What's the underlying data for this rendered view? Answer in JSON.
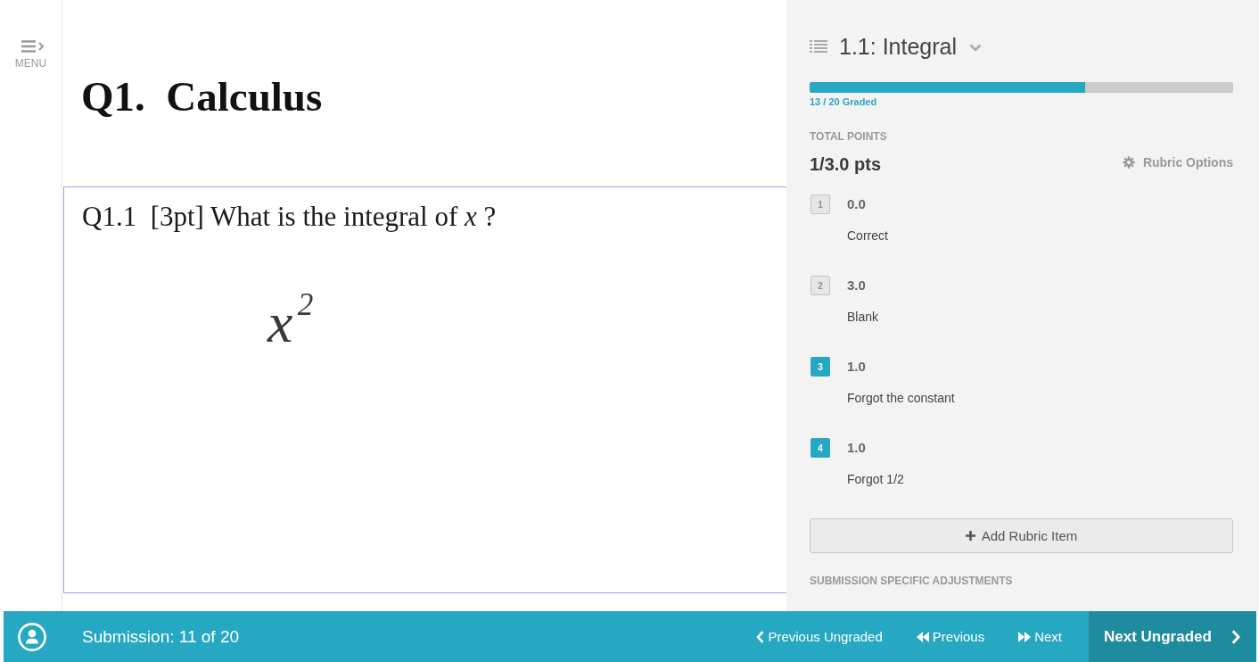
{
  "sidebar": {
    "menu_label": "MENU"
  },
  "document": {
    "heading": "Q1.  Calculus",
    "question": "Q1.1  [3pt] What is the integral of *x* ?",
    "answer": "x$^{2}$"
  },
  "grading_panel": {
    "question_title": "1.1: Integral",
    "progress": {
      "level": 0.65,
      "label": "13 / 20 Graded"
    },
    "total_points_label": "TOTAL POINTS",
    "total_points": "1/3.0 pts",
    "rubric_options_label": "Rubric Options",
    "rubric_items": [
      {
        "key": "1",
        "points": "0.0",
        "description": "Correct",
        "selected": false
      },
      {
        "key": "2",
        "points": "3.0",
        "description": "Blank",
        "selected": false
      },
      {
        "key": "3",
        "points": "1.0",
        "description": "Forgot the constant",
        "selected": true
      },
      {
        "key": "4",
        "points": "1.0",
        "description": "Forgot 1/2",
        "selected": true
      }
    ],
    "add_button_label": "Add Rubric Item",
    "adjustments_heading": "SUBMISSION SPECIFIC ADJUSTMENTS"
  },
  "bottom_bar": {
    "submission": "Submission: 11 of 20",
    "nav_buttons": [
      {
        "label": "Previous Ungraded",
        "kind": "previous_ungraded"
      },
      {
        "label": "Previous",
        "kind": "previous"
      },
      {
        "label": "Next",
        "kind": "next"
      },
      {
        "label": "Next Ungraded",
        "kind": "next_ungraded"
      }
    ]
  }
}
